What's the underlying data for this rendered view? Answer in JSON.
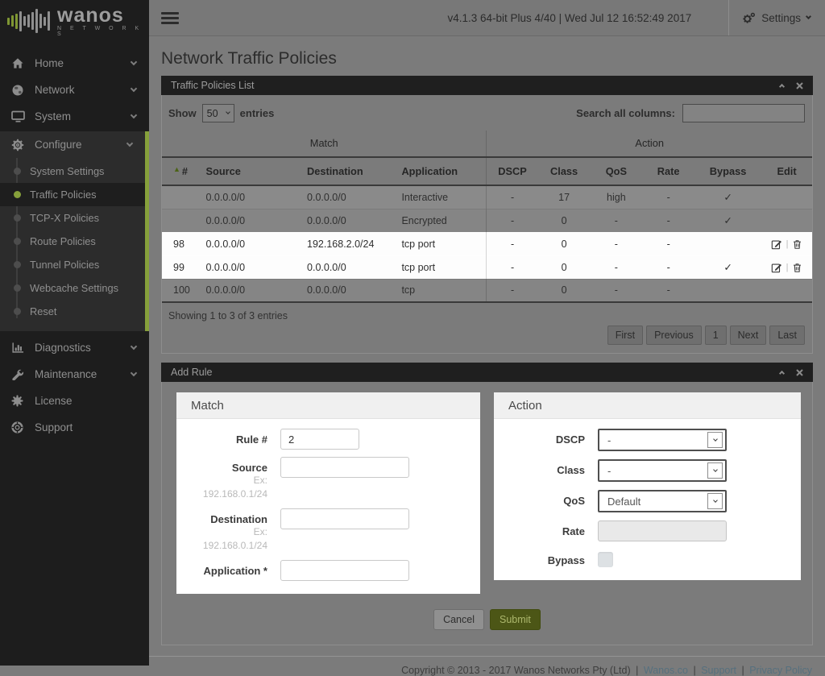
{
  "colors": {
    "accent_green": "#86a03b",
    "submit_green": "#4c5616",
    "panel_header_bg": "#1f1f1f",
    "content_bg": "#7b7b7b",
    "highlight_row": "#fdfdfd",
    "sidebar_bg": "#1d1d1d"
  },
  "icons": {
    "menu-icon": "hamburger",
    "home-icon": "house",
    "network-icon": "globe",
    "system-icon": "monitor",
    "configure-icon": "gear",
    "diagnostics-icon": "bar-chart",
    "maintenance-icon": "wrench",
    "license-icon": "badge",
    "support-icon": "life-ring",
    "settings-icon": "gears",
    "collapse-icon": "chevron-up",
    "close-icon": "x-cross",
    "sort-asc-icon": "▲",
    "check-icon": "✓",
    "edit-icon": "pencil-square",
    "delete-icon": "trash"
  },
  "brand": {
    "name": "wanos",
    "tagline": "N E T W O R K S"
  },
  "topbar": {
    "status": "v4.1.3 64-bit Plus 4/40 | Wed Jul 12 16:52:49 2017",
    "settings_label": "Settings"
  },
  "sidebar": {
    "items": [
      {
        "label": "Home"
      },
      {
        "label": "Network"
      },
      {
        "label": "System"
      },
      {
        "label": "Configure"
      },
      {
        "label": "Diagnostics"
      },
      {
        "label": "Maintenance"
      },
      {
        "label": "License"
      },
      {
        "label": "Support"
      }
    ],
    "configure_submenu": {
      "active": "Traffic Policies",
      "items": [
        {
          "label": "System Settings"
        },
        {
          "label": "Traffic Policies"
        },
        {
          "label": "TCP-X Policies"
        },
        {
          "label": "Route Policies"
        },
        {
          "label": "Tunnel Policies"
        },
        {
          "label": "Webcache Settings"
        },
        {
          "label": "Reset"
        }
      ]
    }
  },
  "page": {
    "title": "Network Traffic Policies"
  },
  "policies_panel": {
    "title": "Traffic Policies List",
    "show_label": "Show",
    "page_length": "50",
    "entries_label": "entries",
    "search_label": "Search all columns:",
    "search_value": "",
    "groups": {
      "match": "Match",
      "action": "Action"
    },
    "columns": [
      "#",
      "Source",
      "Destination",
      "Application",
      "DSCP",
      "Class",
      "QoS",
      "Rate",
      "Bypass",
      "Edit"
    ],
    "rows": [
      {
        "num": "",
        "source": "0.0.0.0/0",
        "destination": "0.0.0.0/0",
        "application": "Interactive",
        "dscp": "-",
        "class": "17",
        "qos": "high",
        "rate": "-",
        "bypass": "✓",
        "highlighted": false,
        "editable": false
      },
      {
        "num": "",
        "source": "0.0.0.0/0",
        "destination": "0.0.0.0/0",
        "application": "Encrypted",
        "dscp": "-",
        "class": "0",
        "qos": "-",
        "rate": "-",
        "bypass": "✓",
        "highlighted": false,
        "editable": false
      },
      {
        "num": "98",
        "source": "0.0.0.0/0",
        "destination": "192.168.2.0/24",
        "application": "tcp port",
        "dscp": "-",
        "class": "0",
        "qos": "-",
        "rate": "-",
        "bypass": "",
        "highlighted": true,
        "editable": true
      },
      {
        "num": "99",
        "source": "0.0.0.0/0",
        "destination": "0.0.0.0/0",
        "application": "tcp port",
        "dscp": "-",
        "class": "0",
        "qos": "-",
        "rate": "-",
        "bypass": "✓",
        "highlighted": true,
        "editable": true
      },
      {
        "num": "100",
        "source": "0.0.0.0/0",
        "destination": "0.0.0.0/0",
        "application": "tcp",
        "dscp": "-",
        "class": "0",
        "qos": "-",
        "rate": "-",
        "bypass": "",
        "highlighted": false,
        "editable": false
      }
    ],
    "summary": "Showing 1 to 3 of 3 entries",
    "pagination": [
      {
        "label": "First"
      },
      {
        "label": "Previous"
      },
      {
        "label": "1",
        "current": true
      },
      {
        "label": "Next"
      },
      {
        "label": "Last"
      }
    ]
  },
  "add_rule_panel": {
    "title": "Add Rule",
    "match": {
      "title": "Match",
      "rule_label": "Rule #",
      "rule_value": "2",
      "source_label": "Source",
      "source_hint_line1": "Ex:",
      "source_hint_line2": "192.168.0.1/24",
      "destination_label": "Destination",
      "destination_hint_line1": "Ex:",
      "destination_hint_line2": "192.168.0.1/24",
      "application_label": "Application *"
    },
    "action": {
      "title": "Action",
      "dscp_label": "DSCP",
      "dscp_value": "-",
      "class_label": "Class",
      "class_value": "-",
      "qos_label": "QoS",
      "qos_value": "Default",
      "rate_label": "Rate",
      "rate_value": "",
      "bypass_label": "Bypass",
      "bypass_checked": false
    },
    "cancel_label": "Cancel",
    "submit_label": "Submit"
  },
  "footer": {
    "copyright": "Copyright © 2013 - 2017 Wanos Networks Pty (Ltd)",
    "separator": "|",
    "links": [
      {
        "label": "Wanos.co"
      },
      {
        "label": "Support"
      },
      {
        "label": "Privacy Policy"
      }
    ]
  }
}
